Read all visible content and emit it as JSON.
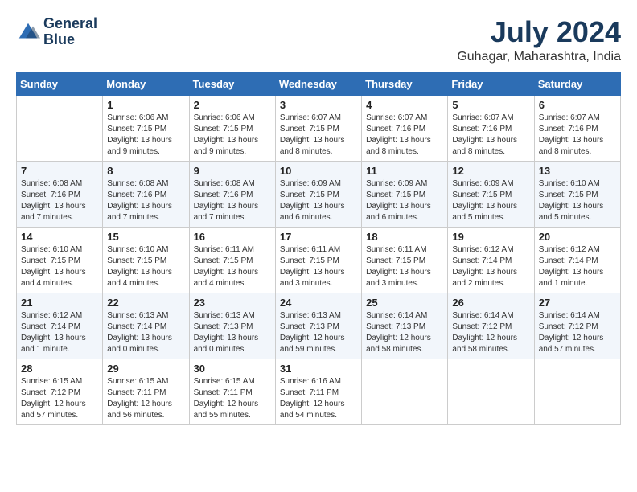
{
  "logo": {
    "line1": "General",
    "line2": "Blue"
  },
  "title": "July 2024",
  "location": "Guhagar, Maharashtra, India",
  "days_of_week": [
    "Sunday",
    "Monday",
    "Tuesday",
    "Wednesday",
    "Thursday",
    "Friday",
    "Saturday"
  ],
  "weeks": [
    [
      {
        "day": "",
        "info": ""
      },
      {
        "day": "1",
        "info": "Sunrise: 6:06 AM\nSunset: 7:15 PM\nDaylight: 13 hours\nand 9 minutes."
      },
      {
        "day": "2",
        "info": "Sunrise: 6:06 AM\nSunset: 7:15 PM\nDaylight: 13 hours\nand 9 minutes."
      },
      {
        "day": "3",
        "info": "Sunrise: 6:07 AM\nSunset: 7:15 PM\nDaylight: 13 hours\nand 8 minutes."
      },
      {
        "day": "4",
        "info": "Sunrise: 6:07 AM\nSunset: 7:16 PM\nDaylight: 13 hours\nand 8 minutes."
      },
      {
        "day": "5",
        "info": "Sunrise: 6:07 AM\nSunset: 7:16 PM\nDaylight: 13 hours\nand 8 minutes."
      },
      {
        "day": "6",
        "info": "Sunrise: 6:07 AM\nSunset: 7:16 PM\nDaylight: 13 hours\nand 8 minutes."
      }
    ],
    [
      {
        "day": "7",
        "info": "Sunrise: 6:08 AM\nSunset: 7:16 PM\nDaylight: 13 hours\nand 7 minutes."
      },
      {
        "day": "8",
        "info": "Sunrise: 6:08 AM\nSunset: 7:16 PM\nDaylight: 13 hours\nand 7 minutes."
      },
      {
        "day": "9",
        "info": "Sunrise: 6:08 AM\nSunset: 7:16 PM\nDaylight: 13 hours\nand 7 minutes."
      },
      {
        "day": "10",
        "info": "Sunrise: 6:09 AM\nSunset: 7:15 PM\nDaylight: 13 hours\nand 6 minutes."
      },
      {
        "day": "11",
        "info": "Sunrise: 6:09 AM\nSunset: 7:15 PM\nDaylight: 13 hours\nand 6 minutes."
      },
      {
        "day": "12",
        "info": "Sunrise: 6:09 AM\nSunset: 7:15 PM\nDaylight: 13 hours\nand 5 minutes."
      },
      {
        "day": "13",
        "info": "Sunrise: 6:10 AM\nSunset: 7:15 PM\nDaylight: 13 hours\nand 5 minutes."
      }
    ],
    [
      {
        "day": "14",
        "info": "Sunrise: 6:10 AM\nSunset: 7:15 PM\nDaylight: 13 hours\nand 4 minutes."
      },
      {
        "day": "15",
        "info": "Sunrise: 6:10 AM\nSunset: 7:15 PM\nDaylight: 13 hours\nand 4 minutes."
      },
      {
        "day": "16",
        "info": "Sunrise: 6:11 AM\nSunset: 7:15 PM\nDaylight: 13 hours\nand 4 minutes."
      },
      {
        "day": "17",
        "info": "Sunrise: 6:11 AM\nSunset: 7:15 PM\nDaylight: 13 hours\nand 3 minutes."
      },
      {
        "day": "18",
        "info": "Sunrise: 6:11 AM\nSunset: 7:15 PM\nDaylight: 13 hours\nand 3 minutes."
      },
      {
        "day": "19",
        "info": "Sunrise: 6:12 AM\nSunset: 7:14 PM\nDaylight: 13 hours\nand 2 minutes."
      },
      {
        "day": "20",
        "info": "Sunrise: 6:12 AM\nSunset: 7:14 PM\nDaylight: 13 hours\nand 1 minute."
      }
    ],
    [
      {
        "day": "21",
        "info": "Sunrise: 6:12 AM\nSunset: 7:14 PM\nDaylight: 13 hours\nand 1 minute."
      },
      {
        "day": "22",
        "info": "Sunrise: 6:13 AM\nSunset: 7:14 PM\nDaylight: 13 hours\nand 0 minutes."
      },
      {
        "day": "23",
        "info": "Sunrise: 6:13 AM\nSunset: 7:13 PM\nDaylight: 13 hours\nand 0 minutes."
      },
      {
        "day": "24",
        "info": "Sunrise: 6:13 AM\nSunset: 7:13 PM\nDaylight: 12 hours\nand 59 minutes."
      },
      {
        "day": "25",
        "info": "Sunrise: 6:14 AM\nSunset: 7:13 PM\nDaylight: 12 hours\nand 58 minutes."
      },
      {
        "day": "26",
        "info": "Sunrise: 6:14 AM\nSunset: 7:12 PM\nDaylight: 12 hours\nand 58 minutes."
      },
      {
        "day": "27",
        "info": "Sunrise: 6:14 AM\nSunset: 7:12 PM\nDaylight: 12 hours\nand 57 minutes."
      }
    ],
    [
      {
        "day": "28",
        "info": "Sunrise: 6:15 AM\nSunset: 7:12 PM\nDaylight: 12 hours\nand 57 minutes."
      },
      {
        "day": "29",
        "info": "Sunrise: 6:15 AM\nSunset: 7:11 PM\nDaylight: 12 hours\nand 56 minutes."
      },
      {
        "day": "30",
        "info": "Sunrise: 6:15 AM\nSunset: 7:11 PM\nDaylight: 12 hours\nand 55 minutes."
      },
      {
        "day": "31",
        "info": "Sunrise: 6:16 AM\nSunset: 7:11 PM\nDaylight: 12 hours\nand 54 minutes."
      },
      {
        "day": "",
        "info": ""
      },
      {
        "day": "",
        "info": ""
      },
      {
        "day": "",
        "info": ""
      }
    ]
  ]
}
